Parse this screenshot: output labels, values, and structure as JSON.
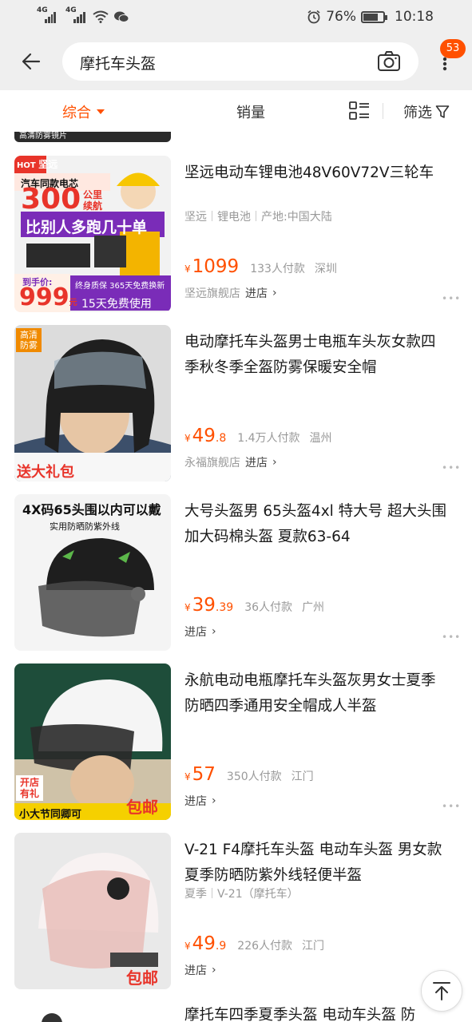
{
  "status_bar": {
    "signal1_tag": "4G",
    "signal2_tag": "4G",
    "battery_percent": "76%",
    "battery_level": 0.76,
    "time": "10:18"
  },
  "search": {
    "query": "摩托车头盔",
    "notification_count": "53"
  },
  "sort_bar": {
    "comprehensive": "综合",
    "sales": "销量",
    "filter": "筛选"
  },
  "partial_top_label": "高清防雾镜片",
  "products": [
    {
      "title": "坚远电动车锂电池48V60V72V三轮车",
      "attrs": [
        "坚远",
        "锂电池",
        "产地:中国大陆"
      ],
      "price_int": "1099",
      "price_dec": "",
      "sales": "133人付款",
      "location": "深圳",
      "shop": "坚远旗舰店",
      "enter": "进店",
      "thumb": {
        "corner_tag": "HOT",
        "brand_tag": "坚远",
        "line1": "汽车同款电芯",
        "big_num": "300",
        "unit1": "公里",
        "unit2": "续航",
        "banner": "比别人多跑几十单",
        "price_label": "到手价:",
        "price": "999",
        "price_unit": "元",
        "warranty": "终身质保 365天免费换新",
        "trial": "15天免费使用"
      }
    },
    {
      "title": "电动摩托车头盔男士电瓶车头灰女款四季秋冬季全盔防雾保暖安全帽",
      "attrs": [],
      "price_int": "49",
      "price_dec": ".8",
      "sales": "1.4万人付款",
      "location": "温州",
      "shop": "永福旗舰店",
      "enter": "进店",
      "thumb": {
        "corner_tag": "高清防雾",
        "bottom_tag": "送大礼包"
      }
    },
    {
      "title": "大号头盔男 65头盔4xl 特大号 超大头围 加大码棉头盔 夏款63-64",
      "attrs": [],
      "price_int": "39",
      "price_dec": ".39",
      "sales": "36人付款",
      "location": "广州",
      "shop": "",
      "enter": "进店",
      "thumb": {
        "headline": "4X码65头围以内可以戴",
        "sub": "实用防晒防紫外线"
      }
    },
    {
      "title": "永航电动电瓶摩托车头盔灰男女士夏季防晒四季通用安全帽成人半盔",
      "attrs": [],
      "price_int": "57",
      "price_dec": "",
      "sales": "350人付款",
      "location": "江门",
      "shop": "",
      "enter": "进店",
      "thumb": {
        "side_tag": "开店 有礼",
        "bottom_tag": "包邮",
        "bottom_text": "小大节同卿可"
      }
    },
    {
      "title": "V-21 F4摩托车头盔 电动车头盔 男女款夏季防晒防紫外线轻便半盔",
      "attrs": [
        "夏季",
        "V-21（摩托车）"
      ],
      "price_int": "49",
      "price_dec": ".9",
      "sales": "226人付款",
      "location": "江门",
      "shop": "",
      "enter": "进店",
      "thumb": {
        "bottom_tag": "包邮"
      }
    }
  ],
  "partial_bottom_title": "摩托车四季夏季头盔 电动车头盔 防"
}
